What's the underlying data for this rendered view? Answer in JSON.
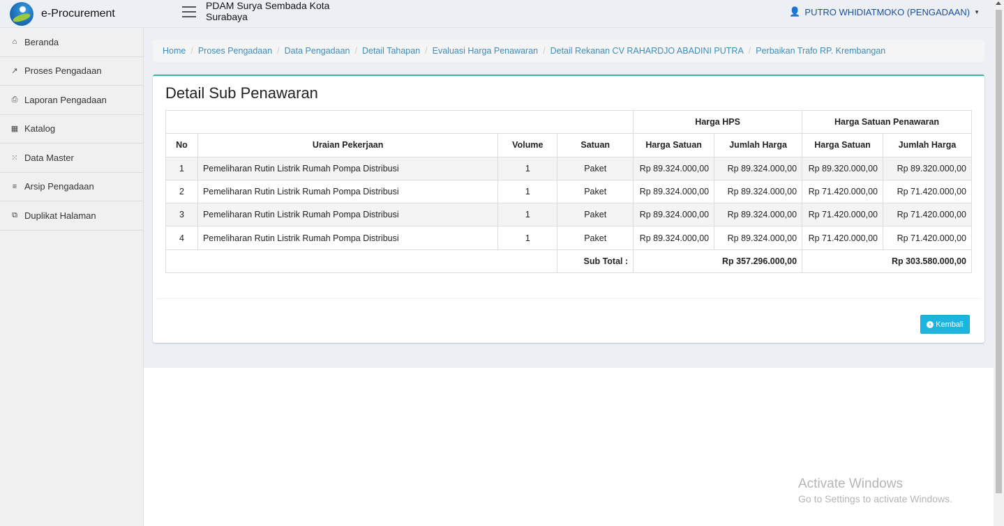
{
  "app": {
    "brand": "e-Procurement",
    "org": "PDAM Surya Sembada Kota Surabaya"
  },
  "user": {
    "name": "PUTRO WHIDIATMOKO (PENGADAAN)"
  },
  "sidebar": {
    "items": [
      {
        "label": "Beranda",
        "icon": "home-icon"
      },
      {
        "label": "Proses Pengadaan",
        "icon": "share-icon"
      },
      {
        "label": "Laporan Pengadaan",
        "icon": "print-icon"
      },
      {
        "label": "Katalog",
        "icon": "barcode-icon"
      },
      {
        "label": "Data Master",
        "icon": "spinner-icon"
      },
      {
        "label": "Arsip Pengadaan",
        "icon": "list-icon"
      },
      {
        "label": "Duplikat Halaman",
        "icon": "copy-icon"
      }
    ]
  },
  "breadcrumb": [
    "Home",
    "Proses Pengadaan",
    "Data Pengadaan",
    "Detail Tahapan",
    "Evaluasi Harga Penawaran",
    "Detail Rekanan CV RAHARDJO ABADINI PUTRA",
    "Perbaikan Trafo RP. Krembangan"
  ],
  "page": {
    "title": "Detail Sub Penawaran"
  },
  "table": {
    "group_headers": {
      "hps": "Harga HPS",
      "penawaran": "Harga Satuan Penawaran"
    },
    "headers": [
      "No",
      "Uraian Pekerjaan",
      "Volume",
      "Satuan",
      "Harga Satuan",
      "Jumlah Harga",
      "Harga Satuan",
      "Jumlah Harga"
    ],
    "rows": [
      [
        "1",
        "Pemeliharan Rutin Listrik Rumah Pompa Distribusi",
        "1",
        "Paket",
        "Rp 89.324.000,00",
        "Rp 89.324.000,00",
        "Rp 89.320.000,00",
        "Rp 89.320.000,00"
      ],
      [
        "2",
        "Pemeliharan Rutin Listrik Rumah Pompa Distribusi",
        "1",
        "Paket",
        "Rp 89.324.000,00",
        "Rp 89.324.000,00",
        "Rp 71.420.000,00",
        "Rp 71.420.000,00"
      ],
      [
        "3",
        "Pemeliharan Rutin Listrik Rumah Pompa Distribusi",
        "1",
        "Paket",
        "Rp 89.324.000,00",
        "Rp 89.324.000,00",
        "Rp 71.420.000,00",
        "Rp 71.420.000,00"
      ],
      [
        "4",
        "Pemeliharan Rutin Listrik Rumah Pompa Distribusi",
        "1",
        "Paket",
        "Rp 89.324.000,00",
        "Rp 89.324.000,00",
        "Rp 71.420.000,00",
        "Rp 71.420.000,00"
      ]
    ],
    "subtotal": {
      "label": "Sub Total :",
      "hps": "Rp 357.296.000,00",
      "penawaran": "Rp 303.580.000,00"
    }
  },
  "buttons": {
    "back": "Kembali"
  },
  "watermark": {
    "title": "Activate Windows",
    "subtitle": "Go to Settings to activate Windows."
  }
}
